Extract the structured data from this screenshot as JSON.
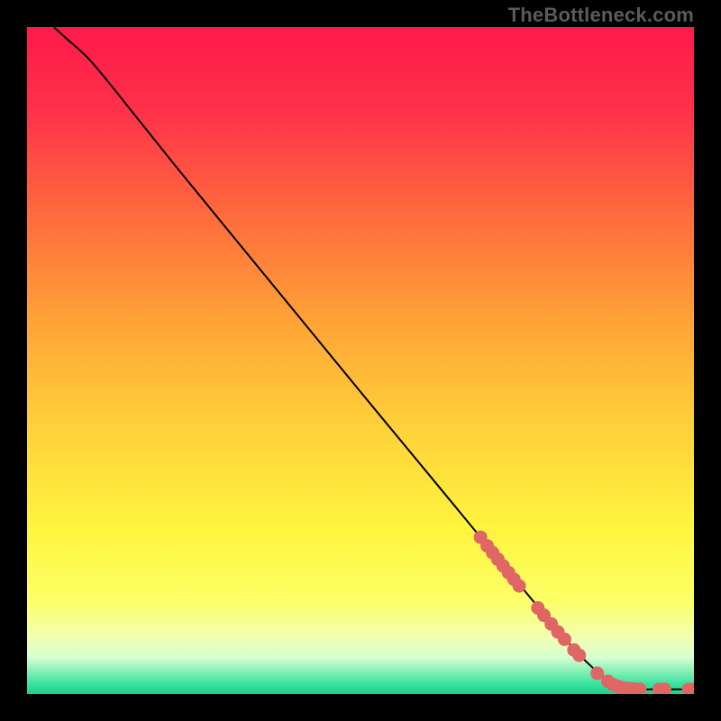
{
  "watermark": "TheBottleneck.com",
  "chart_data": {
    "type": "line",
    "title": "",
    "xlabel": "",
    "ylabel": "",
    "xlim": [
      0,
      100
    ],
    "ylim": [
      0,
      100
    ],
    "grid": false,
    "legend": false,
    "background_gradient_stops": [
      {
        "offset": 0.0,
        "color": "#ff1a4b"
      },
      {
        "offset": 0.12,
        "color": "#ff2f4a"
      },
      {
        "offset": 0.28,
        "color": "#ff6a3d"
      },
      {
        "offset": 0.45,
        "color": "#ffa636"
      },
      {
        "offset": 0.6,
        "color": "#ffd13a"
      },
      {
        "offset": 0.75,
        "color": "#fff43e"
      },
      {
        "offset": 0.86,
        "color": "#fcff66"
      },
      {
        "offset": 0.915,
        "color": "#f3ffb0"
      },
      {
        "offset": 0.945,
        "color": "#d6ffd0"
      },
      {
        "offset": 0.965,
        "color": "#8af0b8"
      },
      {
        "offset": 0.985,
        "color": "#39e29e"
      },
      {
        "offset": 1.0,
        "color": "#1ad18c"
      }
    ],
    "curve_points": [
      {
        "x": 4.0,
        "y": 100.0
      },
      {
        "x": 6.0,
        "y": 98.2
      },
      {
        "x": 9.0,
        "y": 95.5
      },
      {
        "x": 12.0,
        "y": 92.0
      },
      {
        "x": 16.0,
        "y": 87.0
      },
      {
        "x": 22.0,
        "y": 79.5
      },
      {
        "x": 30.0,
        "y": 69.7
      },
      {
        "x": 40.0,
        "y": 57.5
      },
      {
        "x": 50.0,
        "y": 45.3
      },
      {
        "x": 60.0,
        "y": 33.2
      },
      {
        "x": 68.0,
        "y": 23.5
      },
      {
        "x": 75.0,
        "y": 15.0
      },
      {
        "x": 80.0,
        "y": 9.0
      },
      {
        "x": 84.0,
        "y": 4.7
      },
      {
        "x": 87.0,
        "y": 2.2
      },
      {
        "x": 89.5,
        "y": 1.0
      },
      {
        "x": 92.0,
        "y": 0.7
      },
      {
        "x": 95.0,
        "y": 0.7
      },
      {
        "x": 100.0,
        "y": 0.7
      }
    ],
    "marker_points": [
      {
        "x": 68.0,
        "y": 23.5
      },
      {
        "x": 69.0,
        "y": 22.2
      },
      {
        "x": 69.8,
        "y": 21.2
      },
      {
        "x": 70.6,
        "y": 20.2
      },
      {
        "x": 71.4,
        "y": 19.2
      },
      {
        "x": 72.2,
        "y": 18.2
      },
      {
        "x": 73.0,
        "y": 17.2
      },
      {
        "x": 73.8,
        "y": 16.2
      },
      {
        "x": 76.6,
        "y": 12.9
      },
      {
        "x": 77.5,
        "y": 11.8
      },
      {
        "x": 78.6,
        "y": 10.5
      },
      {
        "x": 79.6,
        "y": 9.3
      },
      {
        "x": 80.6,
        "y": 8.2
      },
      {
        "x": 82.0,
        "y": 6.6
      },
      {
        "x": 82.8,
        "y": 5.8
      },
      {
        "x": 85.5,
        "y": 3.1
      },
      {
        "x": 87.1,
        "y": 1.9
      },
      {
        "x": 87.9,
        "y": 1.4
      },
      {
        "x": 88.7,
        "y": 1.1
      },
      {
        "x": 89.5,
        "y": 0.9
      },
      {
        "x": 90.3,
        "y": 0.8
      },
      {
        "x": 91.1,
        "y": 0.75
      },
      {
        "x": 91.9,
        "y": 0.7
      },
      {
        "x": 94.8,
        "y": 0.7
      },
      {
        "x": 95.6,
        "y": 0.7
      },
      {
        "x": 99.2,
        "y": 0.7
      },
      {
        "x": 100.0,
        "y": 0.7
      }
    ],
    "marker_color": "#e06666",
    "curve_color": "#000000"
  }
}
